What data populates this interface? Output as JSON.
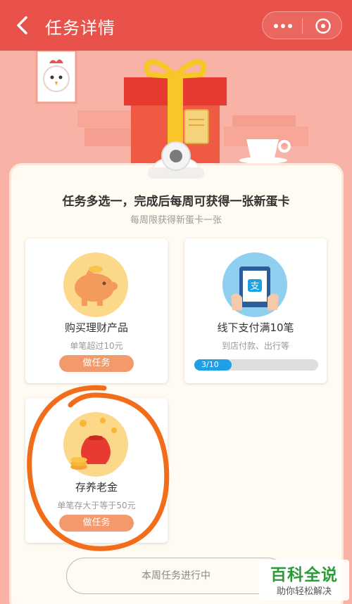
{
  "header": {
    "title": "任务详情",
    "back_icon": "back-arrow-icon",
    "more_icon": "more-dots-icon",
    "close_icon": "close-target-icon"
  },
  "colors": {
    "header_bg": "#e8524b",
    "page_bg": "#f8b3a6",
    "button": "#f29a6c",
    "progress": "#1ea0e6"
  },
  "main": {
    "headline": "任务多选一，完成后每周可获得一张新蛋卡",
    "subline": "每周限获得新蛋卡一张"
  },
  "tasks": [
    {
      "icon": "piggy-bank-icon",
      "name": "购买理财产品",
      "desc": "单笔超过10元",
      "button": "做任务"
    },
    {
      "icon": "alipay-tablet-icon",
      "name": "线下支付满10笔",
      "desc": "到店付款、出行等",
      "progress": {
        "label": "3/10",
        "value": 0.3
      }
    },
    {
      "icon": "money-bag-icon",
      "name": "存养老金",
      "desc": "单笔存大于等于50元",
      "button": "做任务"
    }
  ],
  "footer": {
    "status": "本周任务进行中"
  },
  "watermark": {
    "title": "百科全说",
    "subtitle": "助你轻松解决"
  }
}
